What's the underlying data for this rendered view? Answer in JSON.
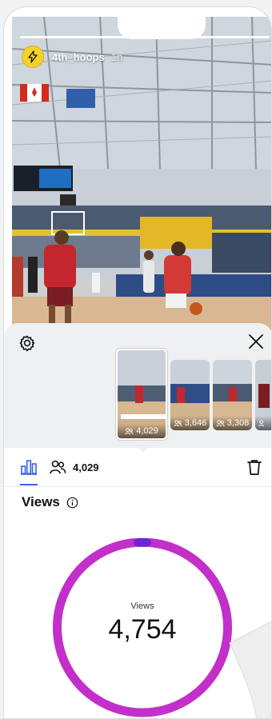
{
  "story": {
    "username": "4th_hoops",
    "time_ago": "1h",
    "avatar_icon": "bolt-icon"
  },
  "thumbnails": [
    {
      "count": "4,029",
      "selected": true
    },
    {
      "count": "3,646",
      "selected": false
    },
    {
      "count": "3,308",
      "selected": false
    },
    {
      "count": "",
      "selected": false
    }
  ],
  "tabs": {
    "insights_icon": "bar-chart-icon",
    "viewers_icon": "people-icon",
    "viewer_count": "4,029"
  },
  "views": {
    "heading": "Views",
    "center_label": "Views",
    "center_value": "4,754"
  },
  "colors": {
    "ring_primary": "#c22fc9",
    "ring_secondary": "#6a25d6",
    "tab_accent": "#3c62e6",
    "avatar_bg": "#f5d12b"
  }
}
